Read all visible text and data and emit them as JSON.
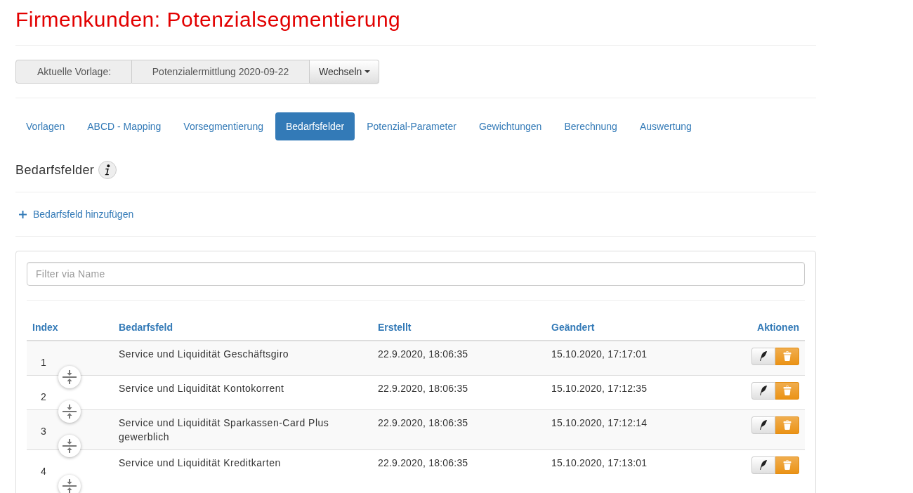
{
  "page": {
    "title": "Firmenkunden: Potenzialsegmentierung"
  },
  "template_bar": {
    "label": "Aktuelle Vorlage:",
    "value": "Potenzialermittlung 2020-09-22",
    "button": "Wechseln"
  },
  "tabs": [
    {
      "label": "Vorlagen",
      "selected": false
    },
    {
      "label": "ABCD - Mapping",
      "selected": false
    },
    {
      "label": "Vorsegmentierung",
      "selected": false
    },
    {
      "label": "Bedarfsfelder",
      "selected": true
    },
    {
      "label": "Potenzial-Parameter",
      "selected": false
    },
    {
      "label": "Gewichtungen",
      "selected": false
    },
    {
      "label": "Berechnung",
      "selected": false
    },
    {
      "label": "Auswertung",
      "selected": false
    }
  ],
  "section": {
    "title": "Bedarfsfelder",
    "add_link": "Bedarfsfeld hinzufügen"
  },
  "filter": {
    "placeholder": "Filter via Name"
  },
  "table": {
    "columns": [
      "Index",
      "Bedarfsfeld",
      "Erstellt",
      "Geändert",
      "Aktionen"
    ],
    "rows": [
      {
        "index": "1",
        "name": "Service und Liquidität Geschäftsgiro",
        "created": "22.9.2020, 18:06:35",
        "changed": "15.10.2020, 17:17:01"
      },
      {
        "index": "2",
        "name": "Service und Liquidität Kontokorrent",
        "created": "22.9.2020, 18:06:35",
        "changed": "15.10.2020, 17:12:35"
      },
      {
        "index": "3",
        "name": "Service und Liquidität Sparkassen-Card Plus gewerblich",
        "created": "22.9.2020, 18:06:35",
        "changed": "15.10.2020, 17:12:14"
      },
      {
        "index": "4",
        "name": "Service und Liquidität Kreditkarten",
        "created": "22.9.2020, 18:06:35",
        "changed": "15.10.2020, 17:13:01"
      }
    ]
  }
}
